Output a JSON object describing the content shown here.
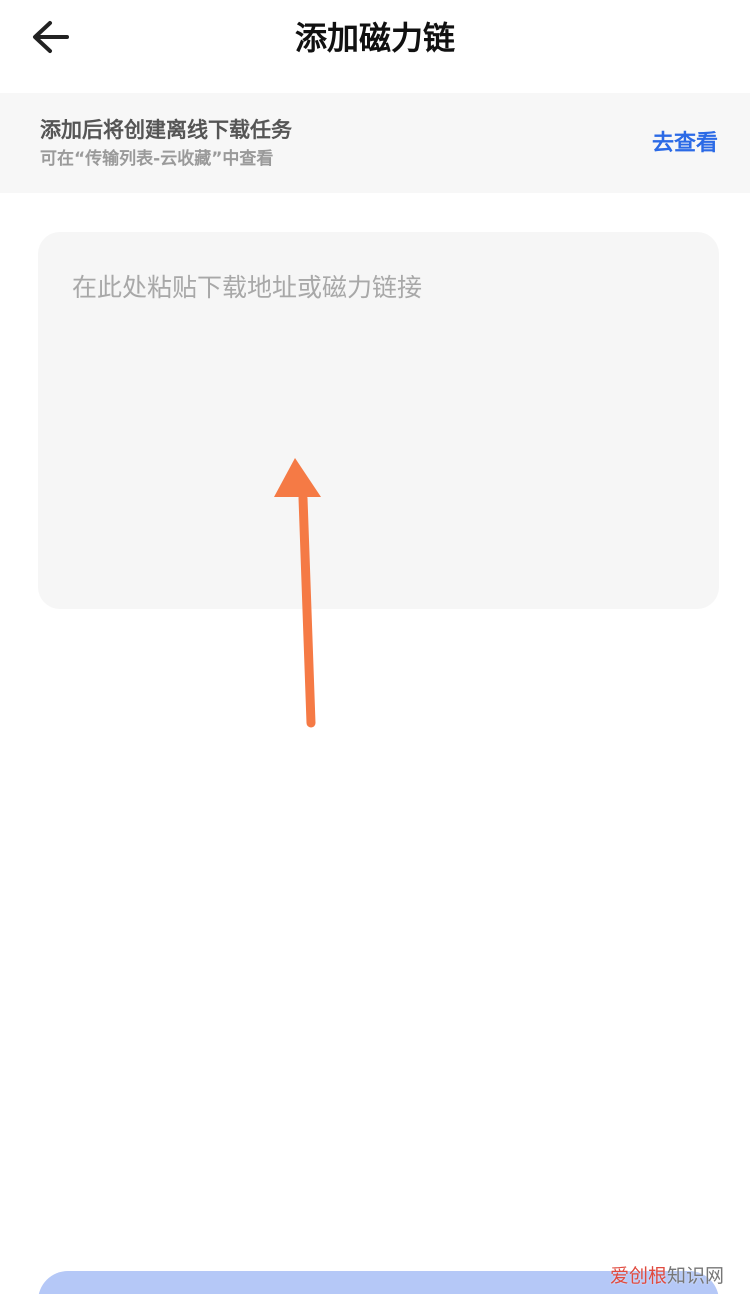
{
  "header": {
    "title": "添加磁力链",
    "back_icon": "arrow-left-icon"
  },
  "banner": {
    "title": "添加后将创建离线下载任务",
    "subtitle": "可在“传输列表-云收藏”中查看",
    "link_label": "去查看"
  },
  "input": {
    "value": "",
    "placeholder": "在此处粘贴下载地址或磁力链接"
  },
  "annotation": {
    "icon": "annotation-arrow-icon",
    "color": "#f57a45"
  },
  "watermark": {
    "brand": "爱创根",
    "suffix": "知识网"
  },
  "colors": {
    "accent": "#2b6ae6",
    "banner_bg": "#f7f7f7",
    "input_bg": "#f6f6f6",
    "button_bg": "#b5c8f7"
  }
}
